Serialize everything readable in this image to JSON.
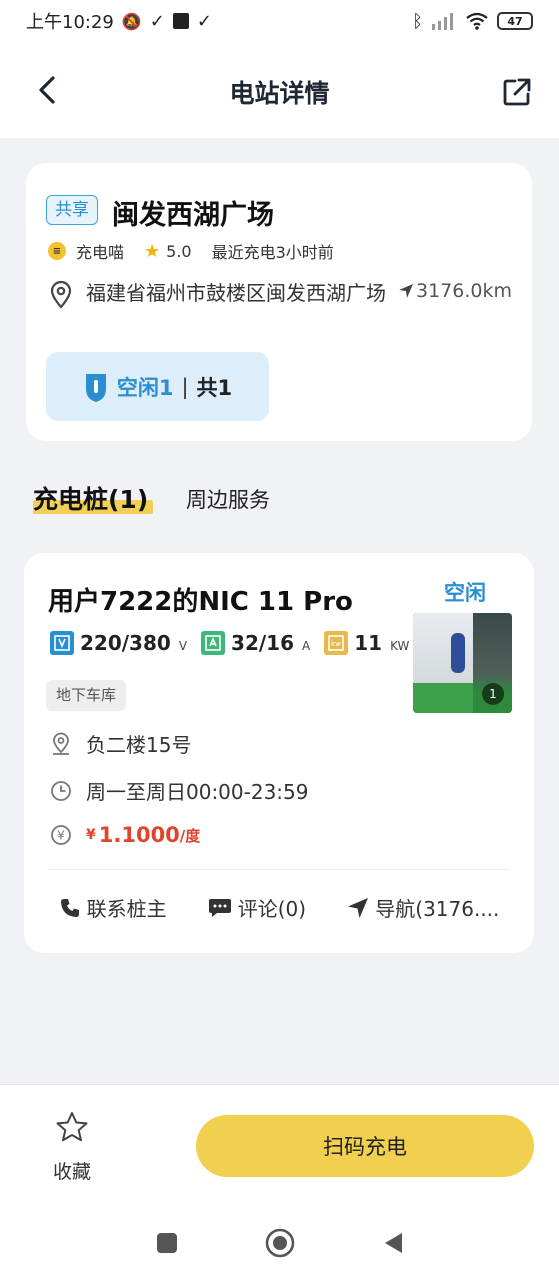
{
  "status_bar": {
    "time": "上午10:29",
    "battery": "47"
  },
  "header": {
    "title": "电站详情"
  },
  "station": {
    "tag": "共享",
    "name": "闽发西湖广场",
    "brand": "充电喵",
    "rating": "5.0",
    "recent": "最近充电3小时前",
    "address": "福建省福州市鼓楼区闽发西湖广场",
    "distance": "3176.0km",
    "available_label": "空闲1",
    "separator": "|",
    "total_label": "共1"
  },
  "tabs": {
    "chargers": "充电桩(1)",
    "nearby": "周边服务"
  },
  "charger": {
    "name": "用户7222的NIC 11 Pro",
    "status": "空闲",
    "voltage": "220/380",
    "voltage_unit": "V",
    "current": "32/16",
    "current_unit": "A",
    "power": "11",
    "power_unit": "KW",
    "location_tag": "地下车库",
    "photo_count": "1",
    "position": "负二楼15号",
    "hours": "周一至周日00:00-23:59",
    "price_currency": "¥",
    "price": "1.1000",
    "price_unit": "/度",
    "actions": {
      "contact": "联系桩主",
      "comments": "评论(0)",
      "navigate": "导航(3176...."
    }
  },
  "bottom": {
    "favorite": "收藏",
    "scan": "扫码充电"
  },
  "colors": {
    "accent_blue": "#2a8fd0",
    "accent_yellow": "#f1cf4f",
    "price_red": "#e0452c"
  }
}
